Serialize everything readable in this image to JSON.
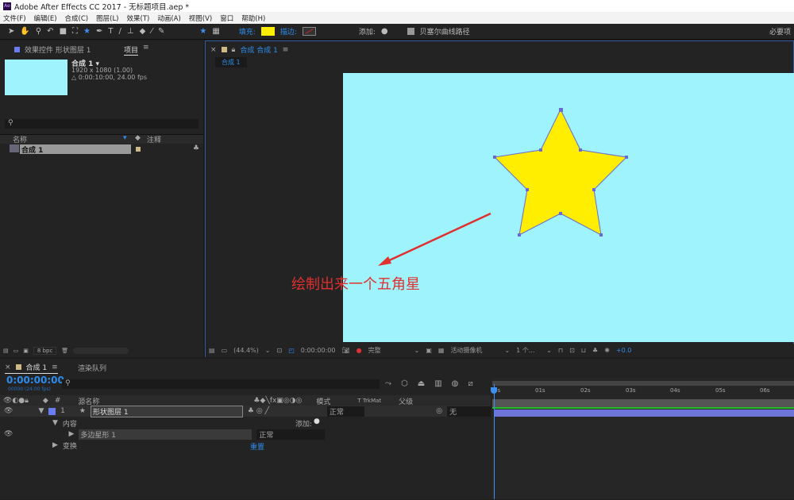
{
  "app": {
    "title": "Adobe After Effects CC 2017 - 无标题项目.aep *",
    "logo": "Ae"
  },
  "menu": [
    "文件(F)",
    "编辑(E)",
    "合成(C)",
    "图层(L)",
    "效果(T)",
    "动画(A)",
    "视图(V)",
    "窗口",
    "帮助(H)"
  ],
  "toolbar": {
    "fill_label": "填充:",
    "stroke_label": "描边:",
    "add_label": "添加:",
    "bezier_label": "贝塞尔曲线路径",
    "workspace": "必要项",
    "fill_color": "#ffee00",
    "stroke_color": "#d42020"
  },
  "project": {
    "tab_effects": "效果控件 形状图层 1",
    "tab_project": "项目",
    "comp_name": "合成 1 ▾",
    "comp_size": "1920 x 1080 (1.00)",
    "comp_duration": "△ 0:00:10:00, 24.00 fps",
    "col_name": "名称",
    "col_comment": "注释",
    "item": "合成 1",
    "bpc": "8 bpc",
    "thumb_color": "#9ef3fc"
  },
  "viewer": {
    "tab": "合成 合成 1",
    "breadcrumb": "合成 1",
    "zoom": "(44.4%)",
    "timecode": "0:00:00:00",
    "quality": "完整",
    "camera": "活动摄像机",
    "views": "1 个...",
    "exposure": "+0.0",
    "annotation": "绘制出来一个五角星",
    "star_fill": "#ffee00"
  },
  "timeline": {
    "tab": "合成 1",
    "tab_render": "渲染队列",
    "timecode": "0:00:00:00",
    "fps": "00000 (24.00 fps)",
    "col_source": "源名称",
    "col_mode": "模式",
    "col_trkmat": "T  TrkMat",
    "col_parent": "父级",
    "layer_num": "1",
    "layer_name": "形状图层 1",
    "layer_mode": "正常",
    "layer_parent": "无",
    "content": "内容",
    "add": "添加:",
    "shape": "多边星形 1",
    "shape_mode": "正常",
    "transform": "变换",
    "reset": "重置",
    "ruler": [
      "0s",
      "01s",
      "02s",
      "03s",
      "04s",
      "05s",
      "06s"
    ]
  }
}
